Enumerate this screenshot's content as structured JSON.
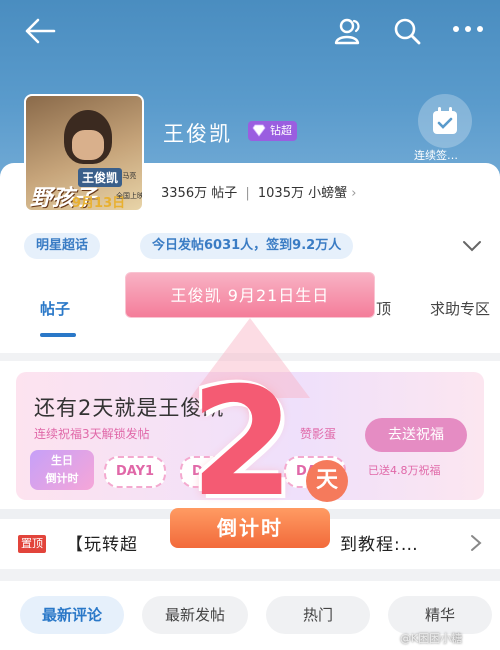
{
  "header": {
    "super_topic_name": "王俊凯",
    "badge_label": "钻超",
    "checkin_label": "连续签…",
    "stats": {
      "posts": "3356万 帖子",
      "separator": "|",
      "fans": "1035万 小螃蟹",
      "arrow": "›"
    }
  },
  "poster": {
    "title": "野孩子",
    "name_tag": "王俊凯",
    "role": "|马亮",
    "date": "9月13日",
    "release": "全国上映"
  },
  "info_pills": {
    "category": "明星超话",
    "today": "今日发帖6031人，签到9.2万人"
  },
  "tabs": [
    {
      "label": "帖子",
      "active": true
    },
    {
      "label": "顶",
      "active": false
    },
    {
      "label": "求助专区",
      "active": false
    }
  ],
  "birthday_banner": {
    "text": "王俊凯 9月21日生日"
  },
  "countdown": {
    "title": "还有2天就是王俊凯",
    "subtitle": "连续祝福3天解锁发帖",
    "subtitle2": "赞影蛋",
    "button": "去送祝福",
    "days": [
      "DAY1",
      "DAY3",
      "DAY5"
    ],
    "helped": "已送4.8万祝福",
    "logo_line1": "生日",
    "logo_line2": "倒计时",
    "big_number": "2",
    "unit": "天",
    "ribbon": "倒计时"
  },
  "pinned": {
    "tag": "置顶",
    "text_start": "【玩转超",
    "text_end": "到教程:…"
  },
  "bottom_tabs": [
    {
      "label": "最新评论",
      "active": true
    },
    {
      "label": "最新发帖",
      "active": false
    },
    {
      "label": "热门",
      "active": false
    },
    {
      "label": "精华",
      "active": false
    }
  ],
  "watermark": "@K困困小糖",
  "colors": {
    "header": "#5a9bcc",
    "accent": "#2a78c8",
    "pink": "#f45b73",
    "orange": "#f26a3b"
  }
}
